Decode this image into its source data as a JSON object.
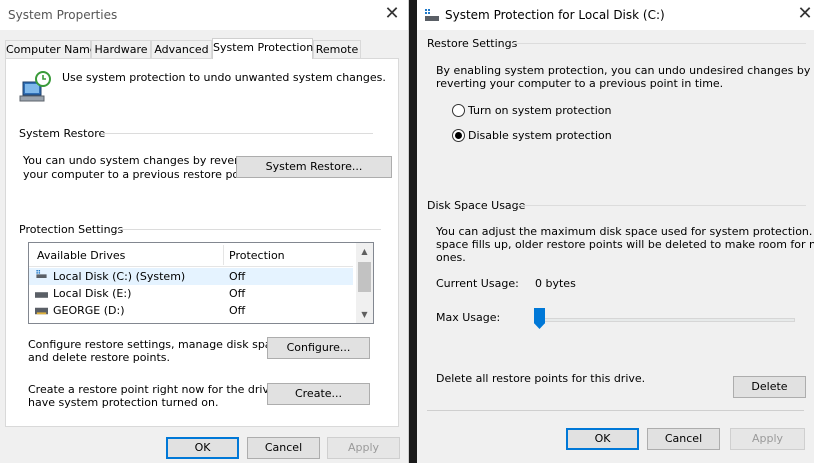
{
  "colors": {
    "accent": "#0078d7",
    "selected_row": "#e5f3ff",
    "window_bg": "#f0f0f0"
  },
  "system_properties": {
    "title": "System Properties",
    "tabs": [
      {
        "label": "Computer Name",
        "active": false
      },
      {
        "label": "Hardware",
        "active": false
      },
      {
        "label": "Advanced",
        "active": false
      },
      {
        "label": "System Protection",
        "active": true
      },
      {
        "label": "Remote",
        "active": false
      }
    ],
    "intro_text": "Use system protection to undo unwanted system changes.",
    "system_restore": {
      "heading": "System Restore",
      "description_line1": "You can undo system changes by reverting",
      "description_line2": "your computer to a previous restore point.",
      "button": "System Restore..."
    },
    "protection_settings": {
      "heading": "Protection Settings",
      "columns": [
        "Available Drives",
        "Protection"
      ],
      "drives": [
        {
          "name": "Local Disk (C:) (System)",
          "protection": "Off",
          "icon": "system-drive-icon",
          "selected": true
        },
        {
          "name": "Local Disk (E:)",
          "protection": "Off",
          "icon": "drive-icon",
          "selected": false
        },
        {
          "name": "GEORGE (D:)",
          "protection": "Off",
          "icon": "usb-drive-icon",
          "selected": false
        }
      ],
      "configure_text_line1": "Configure restore settings, manage disk space,",
      "configure_text_line2": "and delete restore points.",
      "configure_button": "Configure...",
      "create_text_line1": "Create a restore point right now for the drives that",
      "create_text_line2": "have system protection turned on.",
      "create_button": "Create..."
    },
    "buttons": {
      "ok": "OK",
      "cancel": "Cancel",
      "apply": "Apply"
    }
  },
  "protection_dialog": {
    "title": "System Protection for Local Disk (C:)",
    "restore_settings": {
      "heading": "Restore Settings",
      "description_line1": "By enabling system protection, you can undo undesired changes by",
      "description_line2": "reverting your computer to a previous point in time.",
      "options": [
        {
          "label": "Turn on system protection",
          "selected": false
        },
        {
          "label": "Disable system protection",
          "selected": true
        }
      ]
    },
    "disk_space": {
      "heading": "Disk Space Usage",
      "description_line1": "You can adjust the maximum disk space used for system protection. As",
      "description_line2": "space fills up, older restore points will be deleted to make room for new",
      "description_line3": "ones.",
      "current_usage_label": "Current Usage:",
      "current_usage_value": "0 bytes",
      "max_usage_label": "Max Usage:",
      "max_usage_fraction": 0,
      "delete_text": "Delete all restore points for this drive.",
      "delete_button": "Delete"
    },
    "buttons": {
      "ok": "OK",
      "cancel": "Cancel",
      "apply": "Apply"
    }
  }
}
